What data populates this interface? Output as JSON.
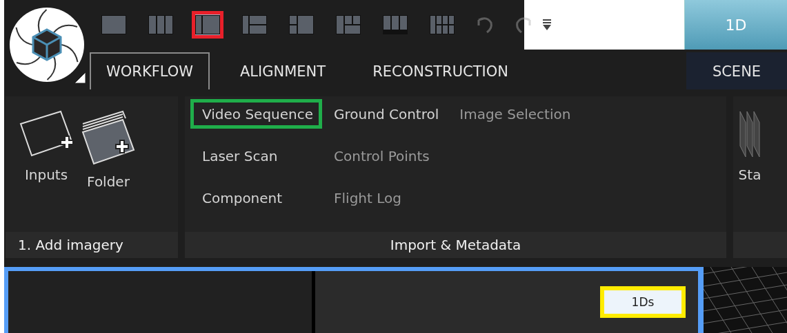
{
  "layout_buttons": [
    {
      "kind": "single",
      "selected": false,
      "outlined": false
    },
    {
      "kind": "columns-3",
      "selected": false,
      "outlined": false
    },
    {
      "kind": "columns-2",
      "selected": true,
      "outlined": true
    },
    {
      "kind": "split-left",
      "selected": false,
      "outlined": false
    },
    {
      "kind": "grid-a",
      "selected": false,
      "outlined": false
    },
    {
      "kind": "grid-b",
      "selected": false,
      "outlined": false
    },
    {
      "kind": "bars",
      "selected": false,
      "outlined": false
    },
    {
      "kind": "grid-4",
      "selected": false,
      "outlined": false
    }
  ],
  "history_buttons": [
    {
      "kind": "undo",
      "disabled": true
    },
    {
      "kind": "redo",
      "disabled": true
    }
  ],
  "top_tab": {
    "label": "1D"
  },
  "tabs": [
    {
      "label": "WORKFLOW",
      "selected": true
    },
    {
      "label": "ALIGNMENT",
      "selected": false
    },
    {
      "label": "RECONSTRUCTION",
      "selected": false
    },
    {
      "label": "SCENE",
      "selected": false
    }
  ],
  "ribbon": {
    "groups": [
      {
        "title": "1. Add imagery",
        "kind": "large",
        "buttons": [
          {
            "label": "Inputs",
            "kind": "inputs"
          },
          {
            "label": "Folder",
            "kind": "folder"
          }
        ]
      },
      {
        "title": "Import & Metadata",
        "kind": "commands",
        "columns": [
          [
            {
              "label": "Video Sequence",
              "disabled": false,
              "outlined": true
            },
            {
              "label": "Laser Scan",
              "disabled": false,
              "outlined": false
            },
            {
              "label": "Component",
              "disabled": false,
              "outlined": false
            }
          ],
          [
            {
              "label": "Ground Control",
              "disabled": false,
              "outlined": false
            },
            {
              "label": "Control Points",
              "disabled": true,
              "outlined": false
            },
            {
              "label": "Flight Log",
              "disabled": true,
              "outlined": false
            }
          ],
          [
            {
              "label": "Image Selection",
              "disabled": true,
              "outlined": false
            }
          ]
        ]
      },
      {
        "kind": "large",
        "buttons": [
          {
            "label": "Sta",
            "kind": "frames"
          }
        ]
      }
    ]
  },
  "viewport": {
    "badge": {
      "label": "1Ds",
      "outlined": true
    }
  }
}
